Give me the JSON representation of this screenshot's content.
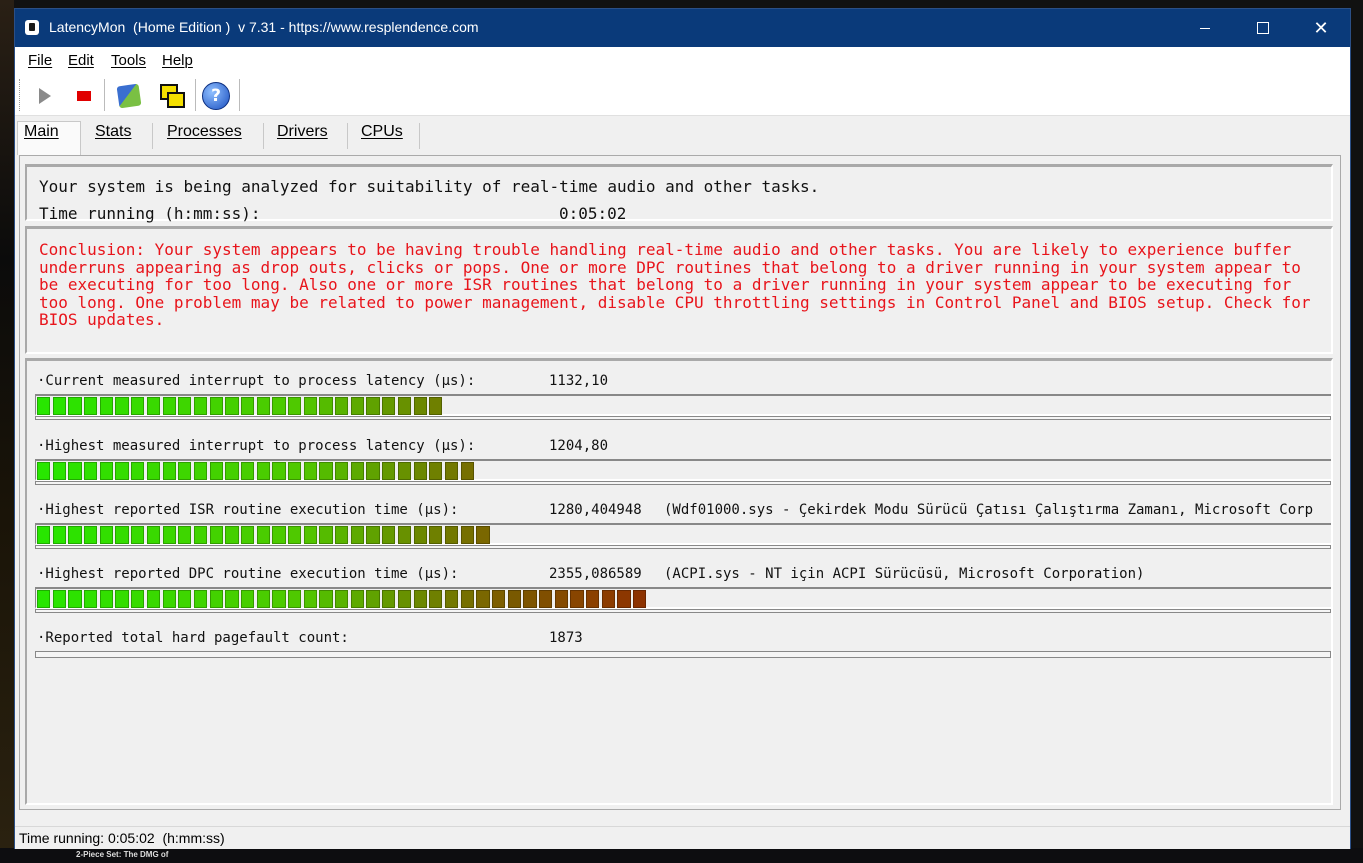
{
  "window": {
    "title": "LatencyMon  (Home Edition )  v 7.31 - https://www.resplendence.com"
  },
  "menu": [
    {
      "label": "File"
    },
    {
      "label": "Edit"
    },
    {
      "label": "Tools"
    },
    {
      "label": "Help"
    }
  ],
  "toolbar": [
    {
      "name": "start-monitoring-button",
      "icon": "play-icon"
    },
    {
      "name": "stop-monitoring-button",
      "icon": "stop-icon"
    },
    {
      "name": "clean-button",
      "icon": "broom-icon"
    },
    {
      "name": "windows-button",
      "icon": "windows-icon"
    },
    {
      "name": "help-button",
      "icon": "help-icon"
    }
  ],
  "tabs": [
    {
      "label": "Main",
      "active": true
    },
    {
      "label": "Stats",
      "active": false
    },
    {
      "label": "Processes",
      "active": false
    },
    {
      "label": "Drivers",
      "active": false
    },
    {
      "label": "CPUs",
      "active": false
    }
  ],
  "summary": {
    "line": "Your system is being analyzed for suitability of real-time audio and other tasks.",
    "time_label": "Time running (h:mm:ss):",
    "time_value": "0:05:02"
  },
  "conclusion": "Conclusion: Your system appears to be having trouble handling real-time audio and other tasks. You are likely to experience buffer underruns appearing as drop outs, clicks or pops. One or more DPC routines that belong to a driver running in your system appear to be executing for too long. Also one or more ISR routines that belong to a driver running in your system appear to be executing for too long. One problem may be related to power management, disable CPU throttling settings in Control Panel and BIOS setup. Check for BIOS updates.",
  "metrics": [
    {
      "label": "·Current measured interrupt to process latency (µs):",
      "value": "1132,10",
      "extra": "",
      "bar_level": 0.31
    },
    {
      "label": "·Highest measured interrupt to process latency (µs):",
      "value": "1204,80",
      "extra": "",
      "bar_level": 0.334
    },
    {
      "label": "·Highest reported ISR routine execution time (µs):",
      "value": "1280,404948",
      "extra": "(Wdf01000.sys - Çekirdek Modu Sürücü Çatısı Çalıştırma Zamanı, Microsoft Corp",
      "bar_level": 0.346
    },
    {
      "label": "·Highest reported DPC routine execution time (µs):",
      "value": "2355,086589",
      "extra": "(ACPI.sys - NT için ACPI Sürücüsü, Microsoft Corporation)",
      "bar_level": 0.474
    },
    {
      "label": "·Reported total hard pagefault count:",
      "value": "1873",
      "extra": "",
      "bar_level": 0
    }
  ],
  "status": "Time running: 0:05:02  (h:mm:ss)",
  "colors": {
    "titlebar": "#0a3a7a",
    "conclusion_text": "#e8141b",
    "bar_green": "#2ee000",
    "bar_olive": "#6a7a00",
    "bar_brown": "#7a3a00"
  },
  "desktop": {
    "taskbar_text": "2-Piece Set: The DMG of"
  }
}
